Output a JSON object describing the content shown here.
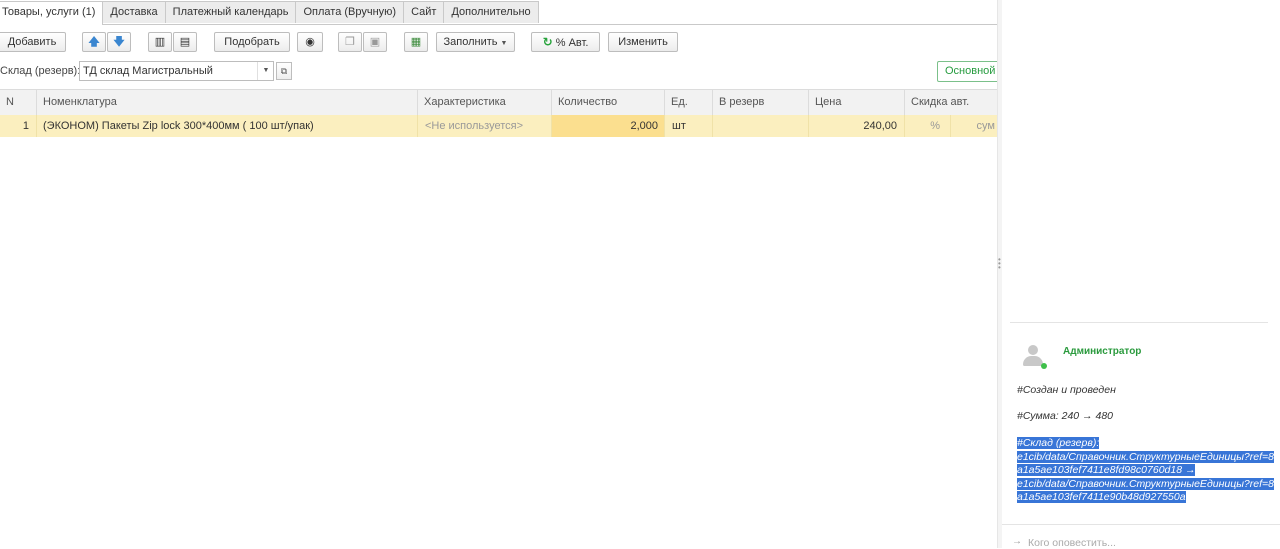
{
  "tabs": [
    {
      "label": "Товары, услуги (1)",
      "active": true
    },
    {
      "label": "Доставка"
    },
    {
      "label": "Платежный календарь"
    },
    {
      "label": "Оплата (Вручную)"
    },
    {
      "label": "Сайт"
    },
    {
      "label": "Дополнительно"
    }
  ],
  "toolbar": {
    "add": "Добавить",
    "pick": "Подобрать",
    "fill": "Заполнить",
    "percent_auto": "% Авт.",
    "change": "Изменить"
  },
  "warehouse": {
    "label": "Склад (резерв):",
    "value": "ТД склад Магистральный",
    "main_button": "Основной"
  },
  "table": {
    "columns": [
      "N",
      "Номенклатура",
      "Характеристика",
      "Количество",
      "Ед.",
      "В резерв",
      "Цена",
      "Скидка авт."
    ],
    "rows": [
      {
        "n": "1",
        "item": "(ЭКОНОМ) Пакеты Zip lock 300*400мм ( 100 шт/упак)",
        "characteristic": "<Не используется>",
        "qty": "2,000",
        "unit": "шт",
        "reserve": "",
        "price": "240,00",
        "discount_pct": "%",
        "discount_sum": "сум"
      }
    ]
  },
  "history": {
    "author": "Администратор",
    "messages": [
      "#Создан и проведен",
      "#Сумма: 240 → 480"
    ],
    "selected_lines": [
      "#Склад (резерв):",
      "e1cib/data/Справочник.СтруктурныеЕдиницы?ref=8",
      "a1a5ae103fef7411e8fd98c0760d18 →",
      "e1cib/data/Справочник.СтруктурныеЕдиницы?ref=8",
      "a1a5ae103fef7411e90b48d927550a"
    ],
    "notify_placeholder": "Кого оповестить..."
  },
  "colors": {
    "row_highlight": "#fbefbf",
    "qty_cell": "#fbdf8f",
    "accent_green": "#2a9a3d",
    "selection": "#3875d7"
  }
}
